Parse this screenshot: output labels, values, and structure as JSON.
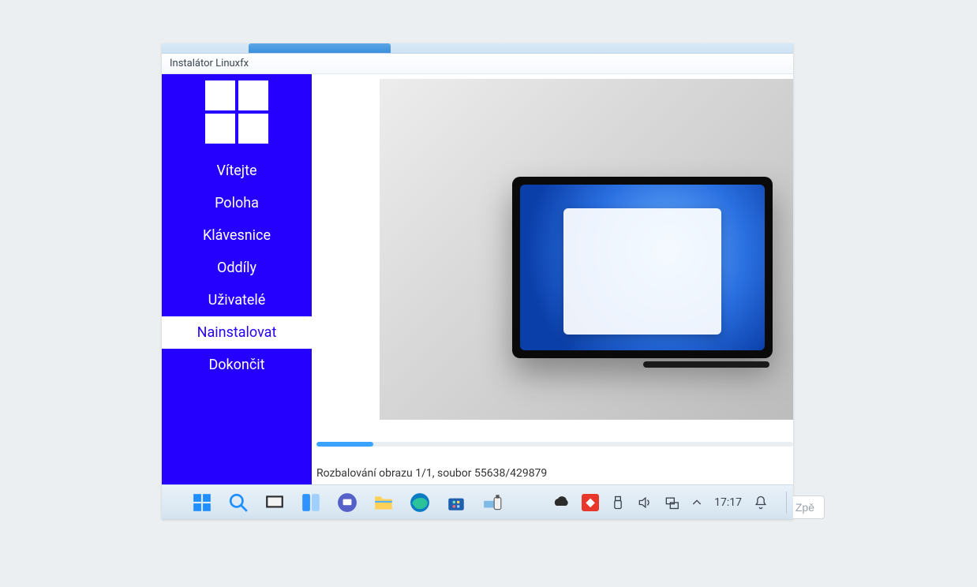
{
  "window": {
    "title": "Instalátor Linuxfx"
  },
  "sidebar": {
    "steps": [
      {
        "label": "Vítejte"
      },
      {
        "label": "Poloha"
      },
      {
        "label": "Klávesnice"
      },
      {
        "label": "Oddíly"
      },
      {
        "label": "Uživatelé"
      },
      {
        "label": "Nainstalovat"
      },
      {
        "label": "Dokončit"
      }
    ],
    "active_index": 5
  },
  "install": {
    "progress_percent": 12,
    "status_text": "Rozbalování obrazu 1/1, soubor 55638/429879",
    "back_label": "Zpě"
  },
  "taskbar": {
    "clock": "17:17"
  }
}
